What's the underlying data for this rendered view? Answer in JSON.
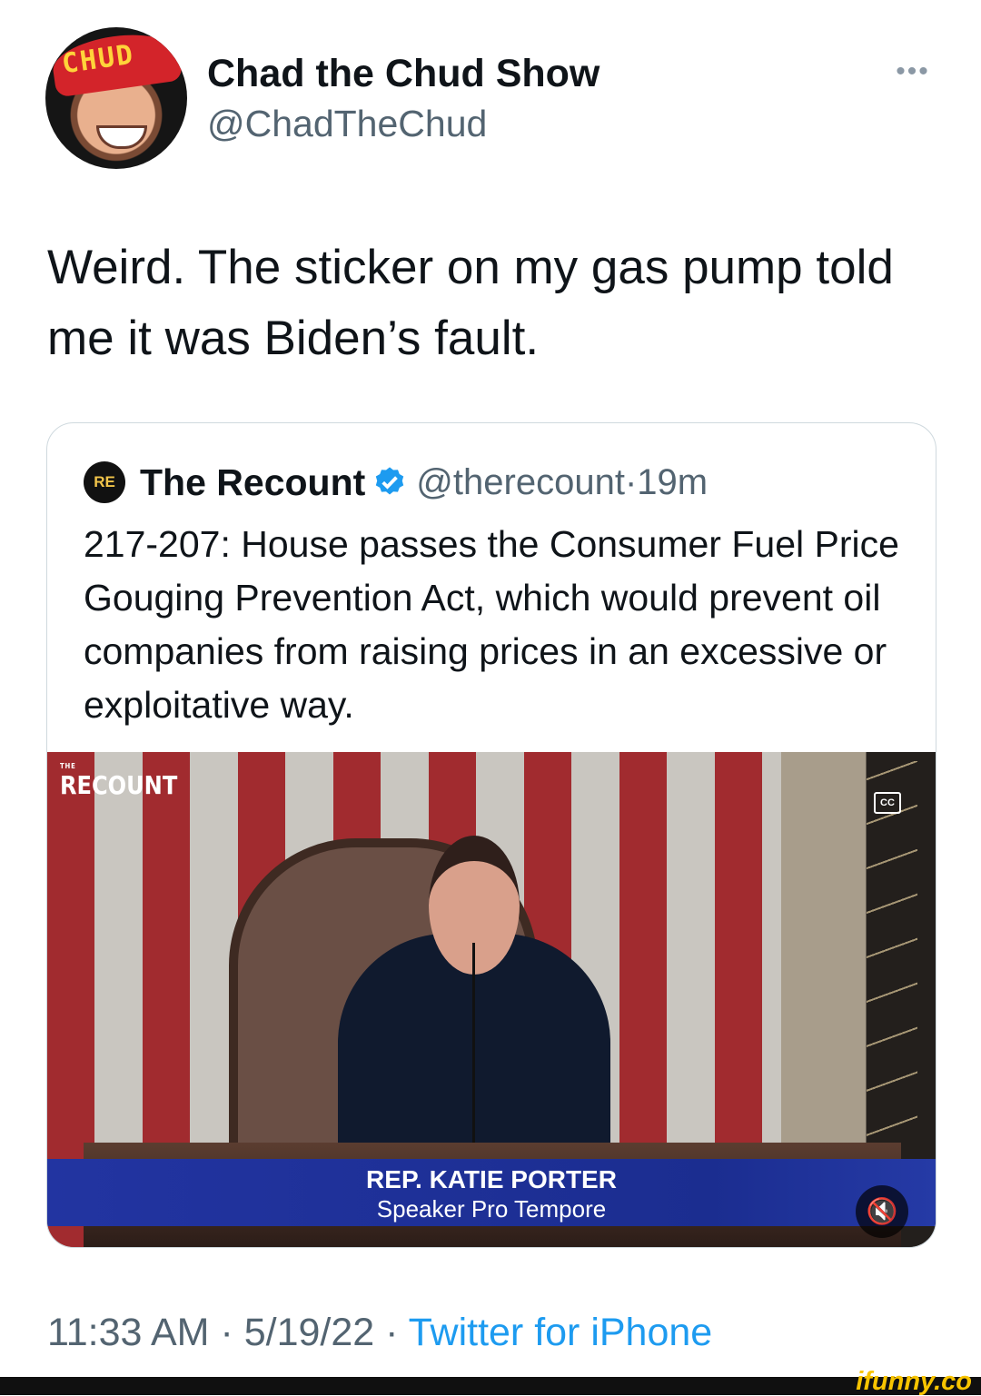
{
  "author": {
    "name": "Chad the Chud Show",
    "handle": "@ChadTheChud",
    "avatar_badge": "CHUD"
  },
  "tweet": {
    "text": "Weird. The sticker on my gas pump told me it was Biden’s fault."
  },
  "quoted_tweet": {
    "logo_text": "RE",
    "name": "The Recount",
    "verified_icon": "verified-badge-icon",
    "handle": "@therecount",
    "separator": " · ",
    "time": "19m",
    "text": "217-207: House passes the Consumer Fuel Price Gouging Prevention Act, which would prevent oil companies from raising prices in an excessive or exploitative way.",
    "media": {
      "watermark_small": "THE",
      "watermark": "RECOUNT",
      "cc_label": "CC",
      "lower_third_name": "REP. KATIE PORTER",
      "lower_third_role": "Speaker Pro Tempore",
      "mute_icon": "speaker-muted-icon"
    }
  },
  "footer": {
    "time": "11:33 AM",
    "separator": " · ",
    "date": "5/19/22",
    "source": "Twitter for iPhone"
  },
  "site_mark": "ifunny.co",
  "colors": {
    "link": "#1d9bf0",
    "secondary_text": "#536471",
    "primary_text": "#0f1419",
    "border": "#cfd9de"
  }
}
